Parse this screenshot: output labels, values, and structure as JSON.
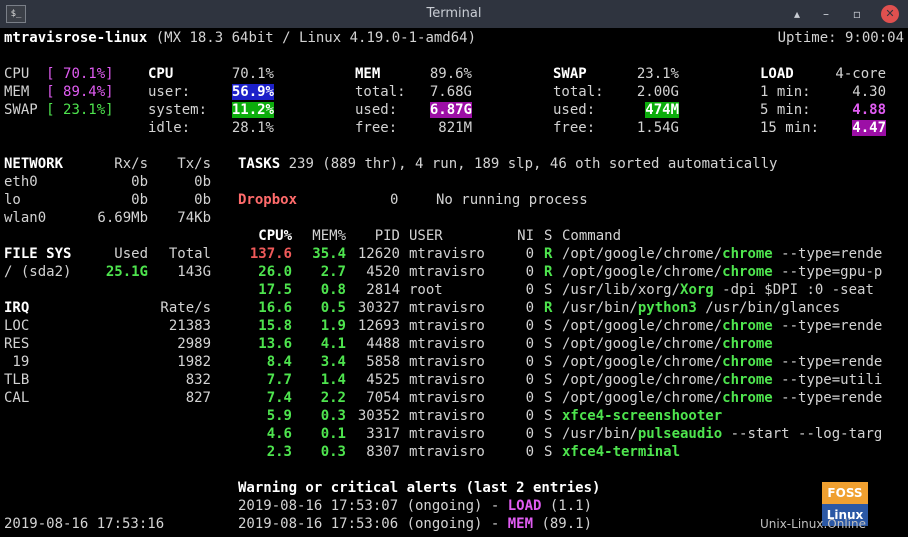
{
  "window": {
    "title": "Terminal",
    "icon_label": "$_",
    "buttons": [
      "▴",
      "–",
      "▫",
      "✕"
    ]
  },
  "header": {
    "host": "mtravisrose-linux",
    "os": "(MX 18.3 64bit / Linux 4.19.0-1-amd64)",
    "uptime": "Uptime: 9:00:04"
  },
  "quicklook": {
    "cpu_label": "CPU",
    "cpu_value": "[ 70.1%]",
    "mem_label": "MEM",
    "mem_value": "[ 89.4%]",
    "swap_label": "SWAP",
    "swap_value": "[ 23.1%]"
  },
  "cpu": {
    "title": "CPU",
    "total": "70.1%",
    "user_label": "user:",
    "user": "56.9%",
    "system_label": "system:",
    "system": "11.2%",
    "idle_label": "idle:",
    "idle": "28.1%"
  },
  "mem": {
    "title": "MEM",
    "percent": "89.6%",
    "total_label": "total:",
    "total": "7.68G",
    "used_label": "used:",
    "used": "6.87G",
    "free_label": "free:",
    "free": "821M"
  },
  "swap": {
    "title": "SWAP",
    "percent": "23.1%",
    "total_label": "total:",
    "total": "2.00G",
    "used_label": "used:",
    "used": "474M",
    "free_label": "free:",
    "free": "1.54G"
  },
  "load": {
    "title": "LOAD",
    "cores": "4-core",
    "min1_label": "1 min:",
    "min1": "4.30",
    "min5_label": "5 min:",
    "min5": "4.88",
    "min15_label": "15 min:",
    "min15": "4.47"
  },
  "network": {
    "title": "NETWORK",
    "rx_label": "Rx/s",
    "tx_label": "Tx/s",
    "rows": [
      {
        "iface": "eth0",
        "rx": "0b",
        "tx": "0b"
      },
      {
        "iface": "lo",
        "rx": "0b",
        "tx": "0b"
      },
      {
        "iface": "wlan0",
        "rx": "6.69Mb",
        "tx": "74Kb"
      }
    ]
  },
  "filesys": {
    "title": "FILE SYS",
    "used_label": "Used",
    "total_label": "Total",
    "mount": "/ (sda2)",
    "used": "25.1G",
    "total": "143G"
  },
  "irq": {
    "title": "IRQ",
    "rate_label": "Rate/s",
    "rows": [
      {
        "name": "LOC",
        "rate": "21383"
      },
      {
        "name": "RES",
        "rate": "2989"
      },
      {
        "name": " 19",
        "rate": "1982"
      },
      {
        "name": "TLB",
        "rate": "832"
      },
      {
        "name": "CAL",
        "rate": "827"
      }
    ]
  },
  "timestamp": "2019-08-16 17:53:16",
  "tasks": {
    "label": "TASKS",
    "text": "239 (889 thr), 4 run, 189 slp, 46 oth sorted automatically"
  },
  "dropbox": {
    "name": "Dropbox",
    "count": "0",
    "status": "No running process"
  },
  "process_headers": {
    "cpu": "CPU%",
    "mem": "MEM%",
    "pid": "PID",
    "user": "USER",
    "ni": "NI",
    "s": "S",
    "command": "Command"
  },
  "processes": [
    {
      "cpu": "137.6",
      "mem": "35.4",
      "pid": "12620",
      "user": "mtravisro",
      "ni": "0",
      "s": "R",
      "cmd_pre": "/opt/google/chrome/",
      "cmd_name": "chrome",
      "cmd_post": " --type=rende"
    },
    {
      "cpu": "26.0",
      "mem": "2.7",
      "pid": "4520",
      "user": "mtravisro",
      "ni": "0",
      "s": "R",
      "cmd_pre": "/opt/google/chrome/",
      "cmd_name": "chrome",
      "cmd_post": " --type=gpu-p"
    },
    {
      "cpu": "17.5",
      "mem": "0.8",
      "pid": "2814",
      "user": "root",
      "ni": "0",
      "s": "S",
      "cmd_pre": "/usr/lib/xorg/",
      "cmd_name": "Xorg",
      "cmd_post": " -dpi $DPI :0 -seat"
    },
    {
      "cpu": "16.6",
      "mem": "0.5",
      "pid": "30327",
      "user": "mtravisro",
      "ni": "0",
      "s": "R",
      "cmd_pre": "/usr/bin/",
      "cmd_name": "python3",
      "cmd_post": " /usr/bin/glances"
    },
    {
      "cpu": "15.8",
      "mem": "1.9",
      "pid": "12693",
      "user": "mtravisro",
      "ni": "0",
      "s": "S",
      "cmd_pre": "/opt/google/chrome/",
      "cmd_name": "chrome",
      "cmd_post": " --type=rende"
    },
    {
      "cpu": "13.6",
      "mem": "4.1",
      "pid": "4488",
      "user": "mtravisro",
      "ni": "0",
      "s": "S",
      "cmd_pre": "/opt/google/chrome/",
      "cmd_name": "chrome",
      "cmd_post": ""
    },
    {
      "cpu": "8.4",
      "mem": "3.4",
      "pid": "5858",
      "user": "mtravisro",
      "ni": "0",
      "s": "S",
      "cmd_pre": "/opt/google/chrome/",
      "cmd_name": "chrome",
      "cmd_post": " --type=rende"
    },
    {
      "cpu": "7.7",
      "mem": "1.4",
      "pid": "4525",
      "user": "mtravisro",
      "ni": "0",
      "s": "S",
      "cmd_pre": "/opt/google/chrome/",
      "cmd_name": "chrome",
      "cmd_post": " --type=utili"
    },
    {
      "cpu": "7.4",
      "mem": "2.2",
      "pid": "7054",
      "user": "mtravisro",
      "ni": "0",
      "s": "S",
      "cmd_pre": "/opt/google/chrome/",
      "cmd_name": "chrome",
      "cmd_post": " --type=rende"
    },
    {
      "cpu": "5.9",
      "mem": "0.3",
      "pid": "30352",
      "user": "mtravisro",
      "ni": "0",
      "s": "S",
      "cmd_pre": "",
      "cmd_name": "xfce4-screenshooter",
      "cmd_post": ""
    },
    {
      "cpu": "4.6",
      "mem": "0.1",
      "pid": "3317",
      "user": "mtravisro",
      "ni": "0",
      "s": "S",
      "cmd_pre": "/usr/bin/",
      "cmd_name": "pulseaudio",
      "cmd_post": " --start --log-targ"
    },
    {
      "cpu": "2.3",
      "mem": "0.3",
      "pid": "8307",
      "user": "mtravisro",
      "ni": "0",
      "s": "S",
      "cmd_pre": "",
      "cmd_name": "xfce4-terminal",
      "cmd_post": ""
    }
  ],
  "alerts": {
    "title": "Warning or critical alerts (last 2 entries)",
    "entries": [
      {
        "prefix": "2019-08-16 17:53:07 (ongoing) - ",
        "metric": "LOAD",
        "value": " (1.1)"
      },
      {
        "prefix": "2019-08-16 17:53:06 (ongoing) - ",
        "metric": "MEM",
        "value": " (89.1)"
      }
    ]
  },
  "watermark": {
    "logo_top": "FOSS",
    "logo_bottom": "Linux",
    "text": "Unix-Linux.Online"
  }
}
